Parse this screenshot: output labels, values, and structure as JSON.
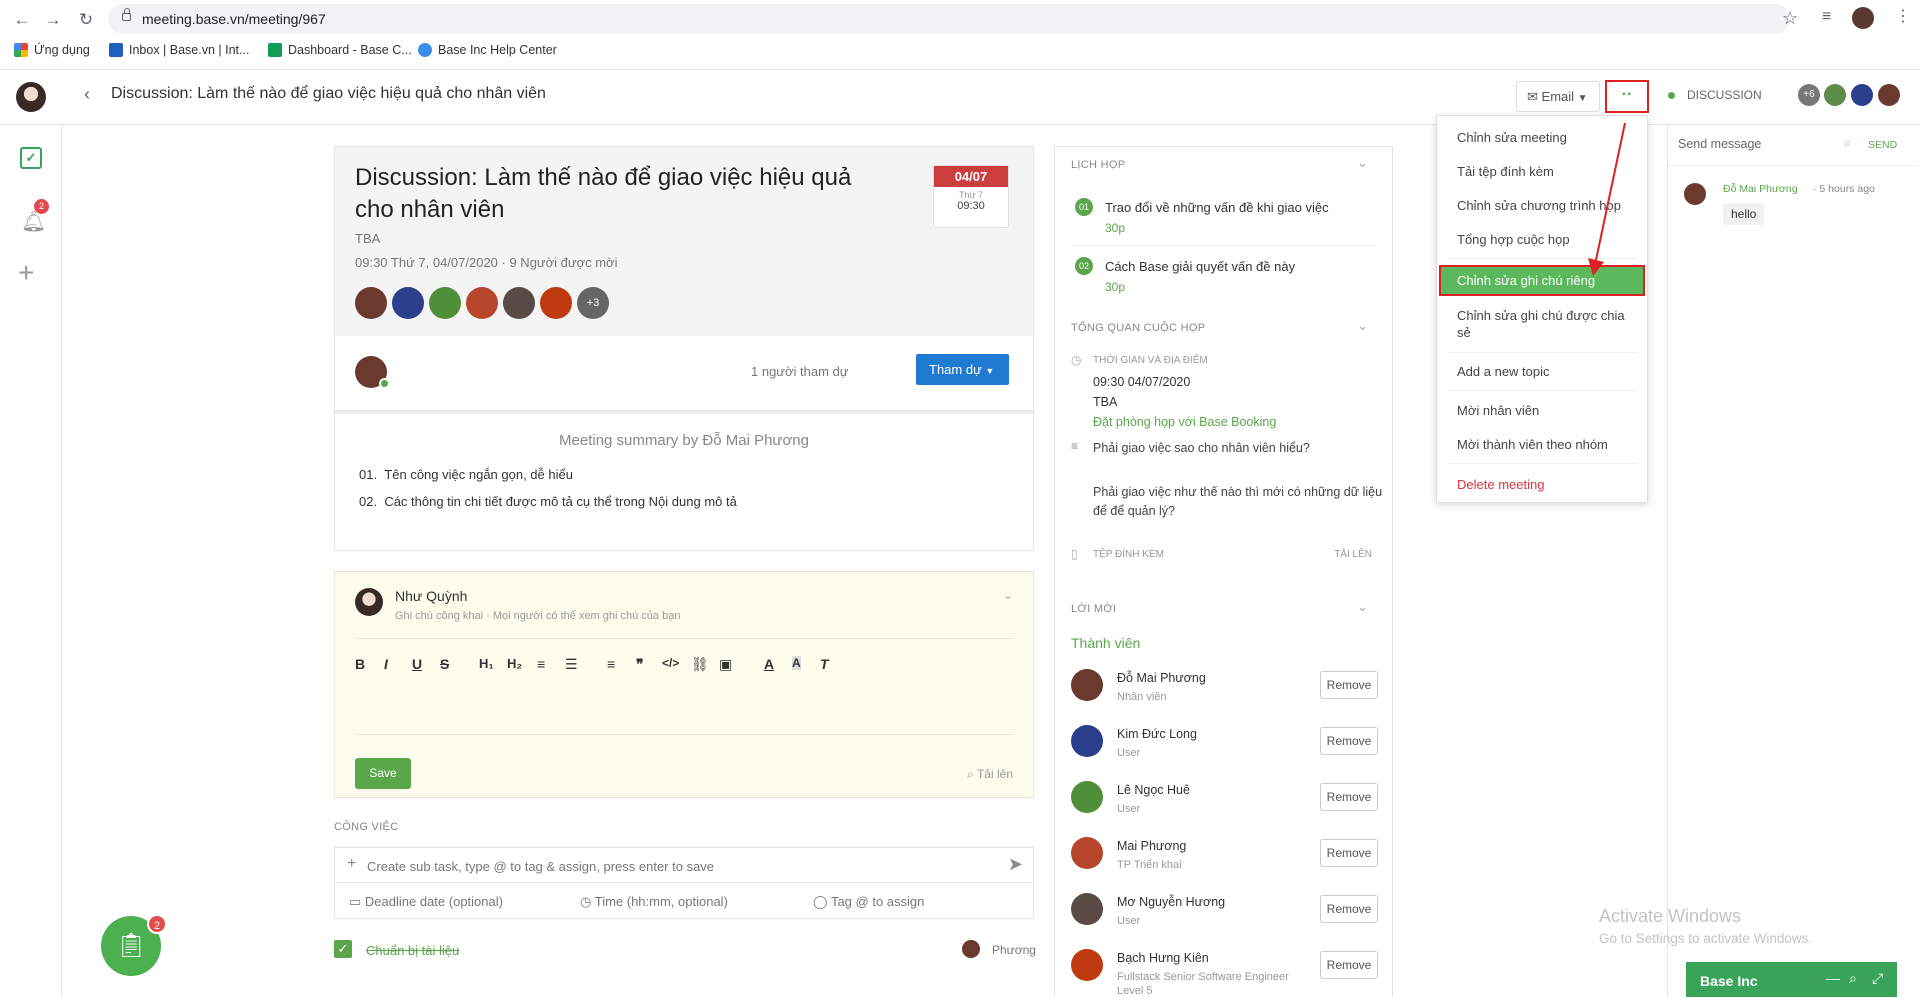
{
  "browser": {
    "url": "meeting.base.vn/meeting/967",
    "bookmarks": [
      "Ứng dụng",
      "Inbox | Base.vn | Int...",
      "Dashboard - Base C...",
      "Base Inc Help Center"
    ]
  },
  "header": {
    "title": "Discussion: Làm thế nào để giao việc hiệu quả cho nhân viên",
    "email_label": "Email",
    "more_label": "··",
    "discussion_label": "DISCUSSION",
    "extra_count": "+6"
  },
  "rail": {
    "notification_count": "2"
  },
  "meeting": {
    "title": "Discussion: Làm thế nào để giao việc hiệu quả cho nhân viên",
    "location": "TBA",
    "datetime": "09:30 Thứ 7, 04/07/2020 · 9 Người được mời",
    "date_badge": "04/07",
    "weekday": "Thứ 7",
    "time": "09:30",
    "more_attendees": "+3",
    "attend_count": "1 người tham dự",
    "attend_button": "Tham dự",
    "summary_title": "Meeting summary by Đỗ Mai Phương",
    "summary_items": [
      {
        "num": "01.",
        "text": "Tên công việc ngắn gọn, dễ hiểu"
      },
      {
        "num": "02.",
        "text": "Các thông tin chi tiết được mô tả cụ thể trong Nội dung mô tả"
      }
    ]
  },
  "note": {
    "author": "Như Quỳnh",
    "hint": "Ghi chú công khai · Mọi người có thể xem ghi chú của bạn",
    "save_label": "Save",
    "upload_label": "Tải lên"
  },
  "tasks": {
    "section_label": "CÔNG VIỆC",
    "input_placeholder": "Create sub task, type @ to tag & assign, press enter to save",
    "deadline_placeholder": "Deadline date (optional)",
    "time_placeholder": "Time (hh:mm, optional)",
    "tag_placeholder": "Tag @ to assign",
    "items": [
      {
        "title": "Chuẩn bị tài liệu",
        "assignee": "Phương"
      }
    ]
  },
  "fab": {
    "count": "2"
  },
  "agenda": {
    "section_label": "LỊCH HỌP",
    "items": [
      {
        "num": "01",
        "title": "Trao đổi về những vấn đề khi giao việc",
        "duration": "30p"
      },
      {
        "num": "02",
        "title": "Cách Base giải quyết vấn đề này",
        "duration": "30p"
      }
    ],
    "overview_label": "TỔNG QUAN CUỘC HỌP",
    "time_place_label": "THỜI GIAN VÀ ĐỊA ĐIỂM",
    "time_value": "09:30 04/07/2020",
    "place_value": "TBA",
    "booking_link": "Đặt phòng họp với Base Booking",
    "questions": [
      "Phải giao việc sao cho nhân viên hiểu?",
      "Phải giao việc như thế nào thì mới có những dữ liệu để để quản lý?"
    ],
    "attachments_label": "TỆP ĐÍNH KÈM",
    "upload_label": "TẢI LÊN",
    "invites_label": "LỜI MỜI",
    "members_label": "Thành viên",
    "remove_label": "Remove",
    "members": [
      {
        "name": "Đỗ Mai Phương",
        "role": "Nhân viên",
        "color": "#6b3a2e"
      },
      {
        "name": "Kim Đức Long",
        "role": "User",
        "color": "#2b3f8c"
      },
      {
        "name": "Lê Ngọc Huê",
        "role": "User",
        "color": "#4f8f3a"
      },
      {
        "name": "Mai Phương",
        "role": "TP Triển khai",
        "color": "#b7462d"
      },
      {
        "name": "Mơ Nguyễn Hương",
        "role": "User",
        "color": "#5a4a46"
      },
      {
        "name": "Bạch Hưng Kiên",
        "role": "Fullstack Senior Software Engineer Level 5",
        "color": "#c03a10"
      }
    ]
  },
  "menu": {
    "items": [
      "Chỉnh sửa meeting",
      "Tải tệp đính kèm",
      "Chỉnh sửa chương trình họp",
      "Tổng hợp cuộc họp",
      "Chỉnh sửa ghi chú riêng",
      "Chỉnh sửa ghi chú được chia sẻ",
      "Add a new topic",
      "Mời nhân viên",
      "Mời thành viên theo nhóm",
      "Delete meeting"
    ],
    "highlight_color": "#5cb85c",
    "danger_color": "#d9363e"
  },
  "chat": {
    "placeholder": "Send message",
    "send_label": "SEND",
    "messages": [
      {
        "author": "Đỗ Mai Phương",
        "time": "· 5 hours ago",
        "text": "hello"
      }
    ],
    "widget_title": "Base Inc"
  },
  "watermark": {
    "title": "Activate Windows",
    "subtitle": "Go to Settings to activate Windows."
  },
  "colors": {
    "brand_green": "#5aa64b",
    "primary_blue": "#1f7bd1",
    "badge_red": "#e54b4b"
  }
}
